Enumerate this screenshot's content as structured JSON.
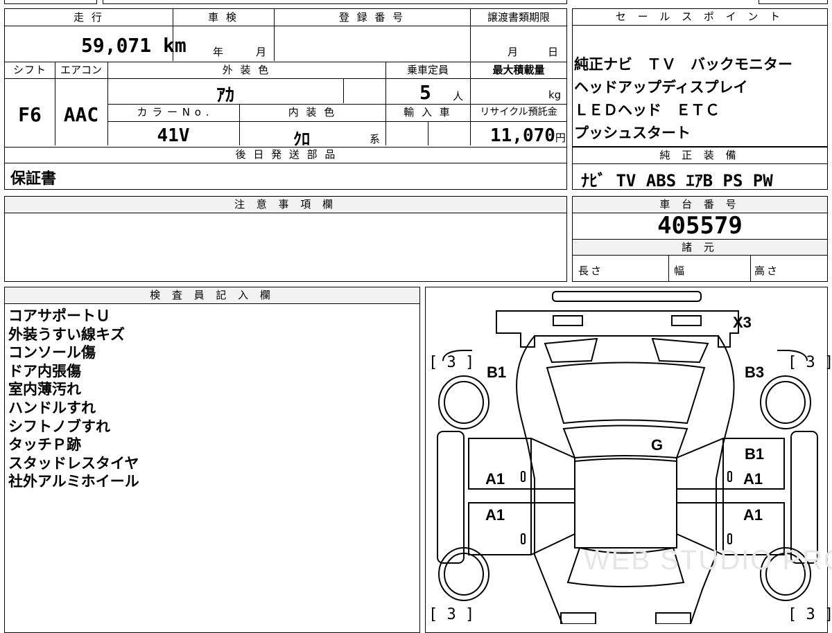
{
  "top_info": {
    "mileage_label": "走 行",
    "mileage_value": "59,071",
    "mileage_unit": "km",
    "inspection_label": "車 検",
    "inspection_year": "年",
    "inspection_month": "月",
    "registration_label": "登 録 番 号",
    "transfer_deadline_label": "譲渡書類期限",
    "transfer_month": "月",
    "transfer_day": "日",
    "shift_label": "シフト",
    "shift_value": "F6",
    "aircon_label": "エアコン",
    "aircon_value": "AAC",
    "exterior_color_label": "外 装 色",
    "exterior_color_value": "ｱｶ",
    "capacity_label": "乗車定員",
    "capacity_value": "5",
    "capacity_unit": "人",
    "max_load_label": "最大積載量",
    "max_load_unit": "kg",
    "color_no_label": "カ ラ ー N o .",
    "color_no_value": "41V",
    "interior_color_label": "内 装 色",
    "interior_color_value": "ｸﾛ",
    "interior_color_suffix": "系",
    "import_label": "輸 入 車",
    "recycle_label": "リサイクル預託金",
    "recycle_value": "11,070",
    "recycle_unit": "円",
    "later_parts_label": "後 日 発 送 部 品",
    "later_parts_value": "保証書"
  },
  "sales_points": {
    "header": "セ ー ル ス ポ イ ン ト",
    "lines": [
      "純正ナビ　ＴＶ　バックモニター",
      "ヘッドアップディスプレイ",
      "ＬＥＤヘッド　ＥＴＣ",
      "プッシュスタート"
    ]
  },
  "genuine_equipment": {
    "header": "純 正 装 備",
    "value": "ﾅﾋﾞ TV ABS ｴｱB PS PW"
  },
  "notes": {
    "header": "注 意 事 項 欄"
  },
  "chassis": {
    "header": "車 台 番 号",
    "value": "405579",
    "specs_header": "諸 元",
    "length_label": "長さ",
    "width_label": "幅",
    "height_label": "高さ"
  },
  "inspector": {
    "header": "検 査 員 記 入 欄",
    "lines": [
      "コアサポートＵ",
      "外装うすい線キズ",
      "コンソール傷",
      "ドア内張傷",
      "室内薄汚れ",
      "ハンドルすれ",
      "シフトノブすれ",
      "タッチＰ跡",
      "スタッドレスタイヤ",
      "社外アルミホイール"
    ]
  },
  "diagram": {
    "marks": {
      "rear_right": "X3",
      "tire_fl": "[ 3 ]",
      "tire_fr": "[ 3 ]",
      "tire_rl": "[ 3 ]",
      "tire_rr": "[ 3 ]",
      "front_fender_left": "B1",
      "front_fender_right": "B3",
      "roof_glass": "G",
      "right_pillar": "B1",
      "left_front_door": "A1",
      "right_front_door": "A1",
      "left_rear_door": "A1",
      "right_rear_door": "A1"
    },
    "watermark": "WEB STUDIO PRO"
  }
}
